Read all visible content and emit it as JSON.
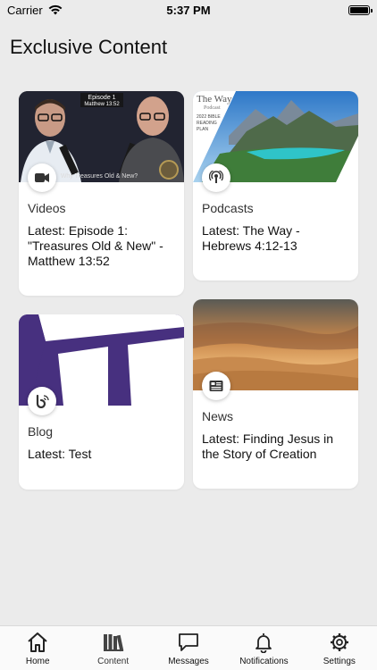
{
  "status": {
    "carrier": "Carrier",
    "time": "5:37 PM"
  },
  "page": {
    "title": "Exclusive Content"
  },
  "cards": [
    {
      "category": "Videos",
      "latest": "Latest: Episode 1: \"Treasures Old & New\" - Matthew 13:52",
      "icon": "video-camera-icon",
      "image_texts": [
        "Episode 1",
        "Matthew 13:52",
        "Why Treasures Old & New?"
      ]
    },
    {
      "category": "Podcasts",
      "latest": "Latest: The Way - Hebrews 4:12-13",
      "icon": "podcast-icon",
      "image_texts": [
        "The Way",
        "Podcast",
        "2022 BIBLE",
        "READING",
        "PLAN"
      ]
    },
    {
      "category": "Blog",
      "latest": "Latest: Test",
      "icon": "blog-icon"
    },
    {
      "category": "News",
      "latest": "Latest: Finding Jesus in the Story of Creation",
      "icon": "newspaper-icon"
    }
  ],
  "tabs": [
    {
      "label": "Home",
      "icon": "home-icon"
    },
    {
      "label": "Content",
      "icon": "library-icon",
      "active": true
    },
    {
      "label": "Messages",
      "icon": "chat-bubble-icon"
    },
    {
      "label": "Notifications",
      "icon": "bell-icon"
    },
    {
      "label": "Settings",
      "icon": "gear-icon"
    }
  ]
}
